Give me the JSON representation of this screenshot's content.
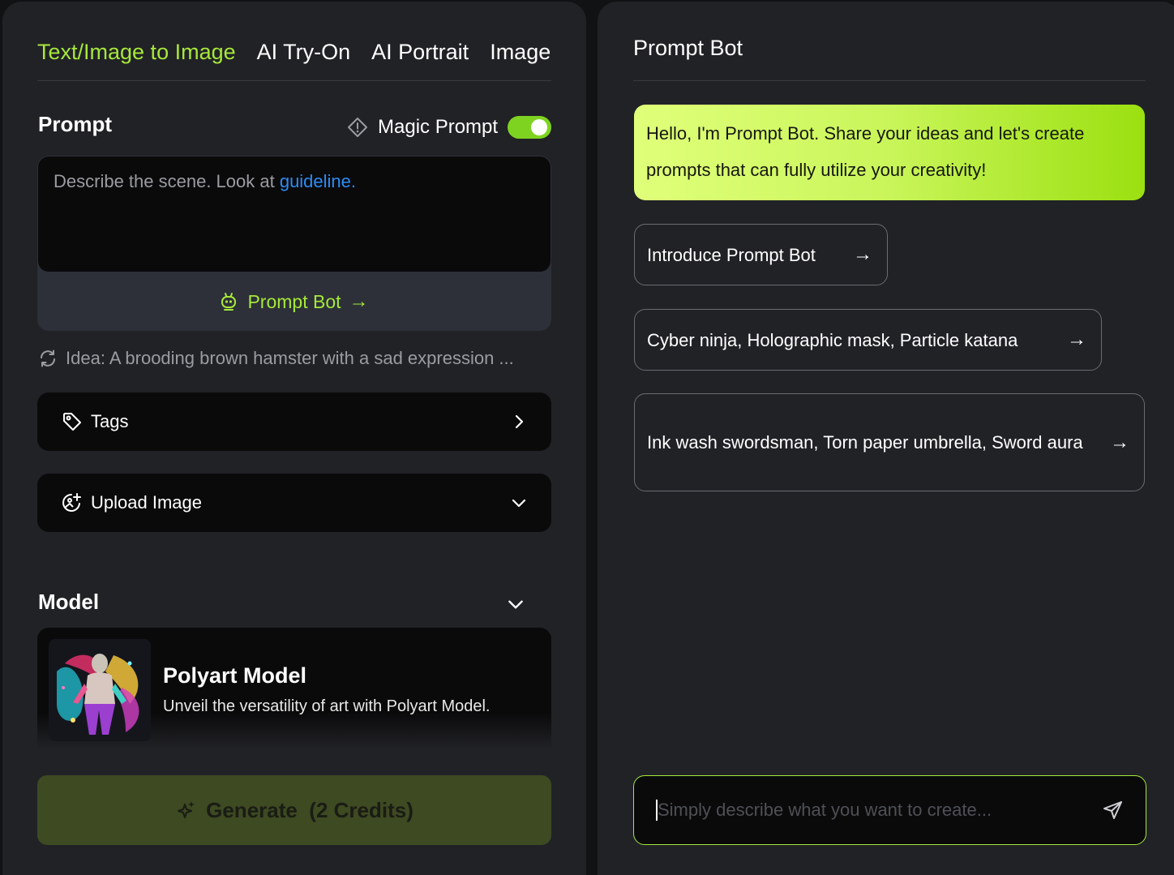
{
  "tabs": [
    {
      "label": "Text/Image to Image",
      "active": true
    },
    {
      "label": "AI Try-On",
      "active": false
    },
    {
      "label": "AI Portrait",
      "active": false
    },
    {
      "label": "Image to Video",
      "active": false
    }
  ],
  "prompt": {
    "title": "Prompt",
    "magic_prompt_label": "Magic Prompt",
    "magic_prompt_on": true,
    "placeholder_text": "Describe the scene. Look at ",
    "guideline_link": "guideline.",
    "prompt_bot_label": "Prompt Bot",
    "prompt_bot_arrow": "→",
    "idea": "Idea: A brooding brown hamster with a sad expression ..."
  },
  "tags": {
    "label": "Tags",
    "icon": "tag-icon"
  },
  "upload": {
    "label": "Upload Image",
    "icon": "image-upload-icon"
  },
  "model": {
    "title": "Model",
    "name": "Polyart Model",
    "description": "Unveil the versatility of art with Polyart Model."
  },
  "generate": {
    "label": "Generate  (2 Credits)",
    "icon": "sparkle-icon"
  },
  "bot": {
    "title": "Prompt Bot",
    "greeting": "Hello, I'm Prompt Bot. Share your ideas and let's create prompts that can fully utilize your creativity!",
    "suggestions": [
      {
        "text": "Introduce Prompt Bot",
        "arrow": "→"
      },
      {
        "text": "Cyber ninja, Holographic mask, Particle katana",
        "arrow": "→"
      },
      {
        "text": "Ink wash swordsman, Torn paper umbrella, Sword aura",
        "arrow": "→"
      }
    ],
    "input_placeholder": "Simply describe what you want to create..."
  },
  "colors": {
    "accent": "#a6e83a",
    "link": "#2b8cf5",
    "panel": "#212226"
  }
}
